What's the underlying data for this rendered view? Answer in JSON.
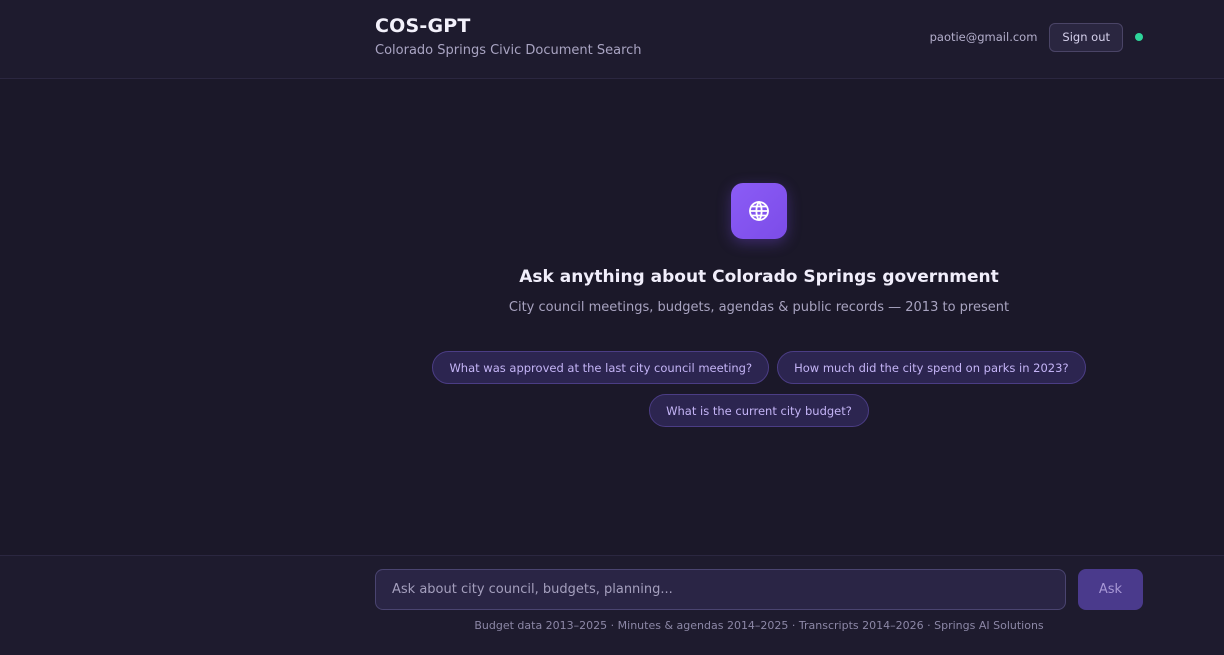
{
  "header": {
    "title": "COS-GPT",
    "subtitle": "Colorado Springs Civic Document Search",
    "user_email": "paotie@gmail.com",
    "sign_out_label": "Sign out",
    "status_color": "#2ed59a"
  },
  "hero": {
    "icon": "globe-icon",
    "title": "Ask anything about Colorado Springs government",
    "subtitle": "City council meetings, budgets, agendas & public records — 2013 to present"
  },
  "suggestions": [
    "What was approved at the last city council meeting?",
    "How much did the city spend on parks in 2023?",
    "What is the current city budget?"
  ],
  "composer": {
    "placeholder": "Ask about city council, budgets, planning...",
    "value": "",
    "ask_label": "Ask"
  },
  "footer": {
    "note": "Budget data 2013–2025 · Minutes & agendas 2014–2025 · Transcripts 2014–2026 · Springs AI Solutions"
  },
  "colors": {
    "background": "#1b1829",
    "accent": "#8b5cf6",
    "chip_background": "#2c2550"
  }
}
